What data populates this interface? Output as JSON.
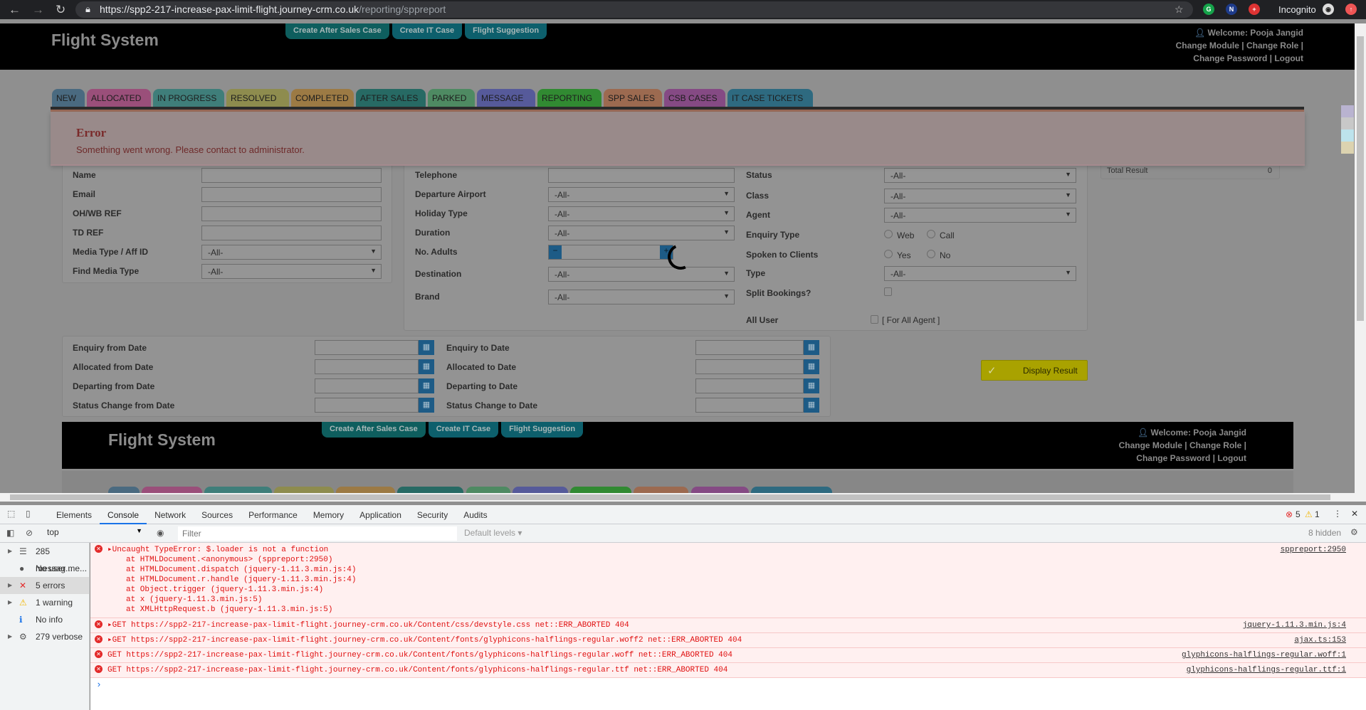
{
  "browser": {
    "url_main": "https://spp2-217-increase-pax-limit-flight.journey-crm.co.uk",
    "url_path": "/reporting/sppreport",
    "incognito": "Incognito"
  },
  "header": {
    "brand": "Flight System",
    "buttons": [
      "Create After Sales Case",
      "Create IT Case",
      "Flight Suggestion"
    ],
    "welcome": "Welcome: Pooja Jangid",
    "change_module": "Change Module",
    "change_role": "Change Role",
    "change_password": "Change Password",
    "logout": "Logout"
  },
  "tabs": [
    {
      "label": "NEW",
      "color": "#4a6a80"
    },
    {
      "label": "ALLOCATED",
      "color": "#9a4f7a"
    },
    {
      "label": "IN PROGRESS",
      "color": "#3f7e7a"
    },
    {
      "label": "RESOLVED",
      "color": "#8e8c4e"
    },
    {
      "label": "COMPLETED",
      "color": "#9c7a44"
    },
    {
      "label": "AFTER SALES",
      "color": "#276a64"
    },
    {
      "label": "PARKED",
      "color": "#4e8a62"
    },
    {
      "label": "MESSAGE",
      "color": "#565a9a"
    },
    {
      "label": "REPORTING",
      "color": "#318a32"
    },
    {
      "label": "SPP SALES",
      "color": "#9c6a50"
    },
    {
      "label": "CSB CASES",
      "color": "#854a84"
    },
    {
      "label": "IT CASE TICKETS",
      "color": "#2e6a80"
    }
  ],
  "error": {
    "title": "Error",
    "message": "Something went wrong. Please contact to administrator."
  },
  "form": {
    "left": [
      {
        "label": "Name",
        "type": "input",
        "value": ""
      },
      {
        "label": "Email",
        "type": "input",
        "value": ""
      },
      {
        "label": "OH/WB REF",
        "type": "input",
        "value": ""
      },
      {
        "label": "TD REF",
        "type": "input",
        "value": ""
      },
      {
        "label": "Media Type / Aff ID",
        "type": "select",
        "value": "-All-"
      },
      {
        "label": "Find Media Type",
        "type": "select",
        "value": "-All-"
      }
    ],
    "middle": [
      {
        "label": "Telephone",
        "type": "input",
        "value": ""
      },
      {
        "label": "Departure Airport",
        "type": "select",
        "value": "-All-"
      },
      {
        "label": "Holiday Type",
        "type": "select",
        "value": "-All-"
      },
      {
        "label": "Duration",
        "type": "select",
        "value": "-All-"
      },
      {
        "label": "No. Adults",
        "type": "stepper",
        "value": "",
        "minus": "−",
        "plus": "+"
      },
      {
        "label": "Destination",
        "type": "select",
        "value": "-All-"
      },
      {
        "label": "Brand",
        "type": "select",
        "value": "-All-"
      }
    ],
    "right": [
      {
        "label": "Status",
        "type": "select",
        "value": "-All-"
      },
      {
        "label": "Class",
        "type": "select",
        "value": "-All-"
      },
      {
        "label": "Agent",
        "type": "select",
        "value": "-All-"
      },
      {
        "label": "Enquiry Type",
        "type": "radio",
        "options": [
          "Web",
          "Call"
        ]
      },
      {
        "label": "Spoken to Clients",
        "type": "radio",
        "options": [
          "Yes",
          "No"
        ]
      },
      {
        "label": "Type",
        "type": "select",
        "value": "-All-"
      },
      {
        "label": "Split Bookings?",
        "type": "checkbox"
      },
      {
        "label": "All User",
        "type": "allagent",
        "note": "[ For All Agent ]"
      }
    ],
    "dates_from": [
      "Enquiry from Date",
      "Allocated from Date",
      "Departing from Date",
      "Status Change from Date"
    ],
    "dates_to": [
      "Enquiry to Date",
      "Allocated to Date",
      "Departing to Date",
      "Status Change to Date"
    ],
    "display_button": "Display Result"
  },
  "total": {
    "label": "Total Result",
    "value": "0"
  },
  "devtools": {
    "tabs": [
      "Elements",
      "Console",
      "Network",
      "Sources",
      "Performance",
      "Memory",
      "Application",
      "Security",
      "Audits"
    ],
    "active_tab": "Console",
    "error_count": "5",
    "warning_count": "1",
    "context": "top",
    "filter_placeholder": "Filter",
    "levels": "Default levels ▾",
    "hidden": "8 hidden",
    "sidebar": [
      {
        "label": "285 messag...",
        "icon": "☰"
      },
      {
        "label": "No user me...",
        "icon": "●"
      },
      {
        "label": "5 errors",
        "icon": "✕"
      },
      {
        "label": "1 warning",
        "icon": "⚠"
      },
      {
        "label": "No info",
        "icon": "ℹ"
      },
      {
        "label": "279 verbose",
        "icon": "⚙"
      }
    ],
    "messages": [
      {
        "text": "▸Uncaught TypeError: $.loader is not a function",
        "stack": [
          "at HTMLDocument.<anonymous> (sppreport:2950)",
          "at HTMLDocument.dispatch (jquery-1.11.3.min.js:4)",
          "at HTMLDocument.r.handle (jquery-1.11.3.min.js:4)",
          "at Object.trigger (jquery-1.11.3.min.js:4)",
          "at x (jquery-1.11.3.min.js:5)",
          "at XMLHttpRequest.b (jquery-1.11.3.min.js:5)"
        ],
        "source": "sppreport:2950"
      },
      {
        "text": "▸GET https://spp2-217-increase-pax-limit-flight.journey-crm.co.uk/Content/css/devstyle.css net::ERR_ABORTED 404",
        "source": "jquery-1.11.3.min.js:4"
      },
      {
        "text": "▸GET https://spp2-217-increase-pax-limit-flight.journey-crm.co.uk/Content/fonts/glyphicons-halflings-regular.woff2 net::ERR_ABORTED 404",
        "source": "ajax.ts:153"
      },
      {
        "text": "GET https://spp2-217-increase-pax-limit-flight.journey-crm.co.uk/Content/fonts/glyphicons-halflings-regular.woff net::ERR_ABORTED 404",
        "source": "glyphicons-halflings-regular.woff:1"
      },
      {
        "text": "GET https://spp2-217-increase-pax-limit-flight.journey-crm.co.uk/Content/fonts/glyphicons-halflings-regular.ttf net::ERR_ABORTED 404",
        "source": "glyphicons-halflings-regular.ttf:1"
      }
    ],
    "prompt": "›"
  }
}
